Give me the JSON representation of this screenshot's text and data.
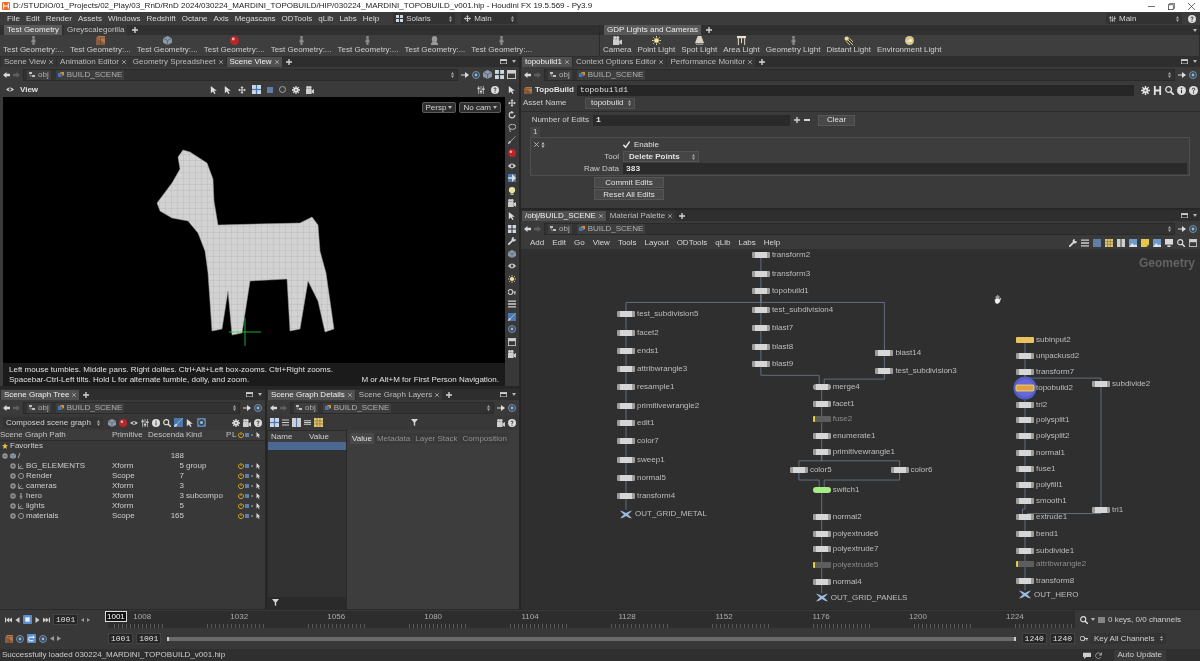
{
  "window": {
    "title": "D:/STUDIO/01_Projects/02_Play/03_RnD/RnD 2024/030224_MARDINI_TOPOBUILD/HIP/030224_MARDINI_TOPOBUILD_v001.hip - Houdini FX 19.5.569 - Py3.9"
  },
  "menu_bar": {
    "items": [
      "File",
      "Edit",
      "Render",
      "Assets",
      "Windows",
      "Redshift",
      "Octane",
      "Axis",
      "Megascans",
      "ODTools",
      "qLib",
      "Labs",
      "Help"
    ],
    "desktop": "Solaris",
    "context": "Main",
    "right_desktop": "Main"
  },
  "shelves": [
    {
      "tabs": [
        {
          "label": "Test Geometry",
          "selected": true
        },
        {
          "label": "Greyscalegorilla",
          "selected": false
        }
      ],
      "tools": [
        "Test Geometry:...",
        "Test Geometry:...",
        "Test Geometry:...",
        "Test Geometry:...",
        "Test Geometry:...",
        "Test Geometry:...",
        "Test Geometry:...",
        "Test Geometry:..."
      ]
    },
    {
      "tabs": [
        {
          "label": "GDP Lights and Cameras",
          "selected": true
        }
      ],
      "tools": [
        "Camera",
        "Point Light",
        "Spot Light",
        "Area Light",
        "Geometry Light",
        "Distant Light",
        "Environment Light"
      ]
    }
  ],
  "scene_view_pane": {
    "tabs": [
      {
        "label": "Scene View",
        "selected": false
      },
      {
        "label": "Animation Editor",
        "selected": false
      },
      {
        "label": "Geometry Spreadsheet",
        "selected": false
      },
      {
        "label": "Scene View",
        "selected": true
      }
    ],
    "path": [
      "obj",
      "BUILD_SCENE"
    ],
    "viewport": {
      "title": "View",
      "camera_menus": [
        "Persp",
        "No cam"
      ],
      "hint": "Left mouse tumbles. Middle pans. Right dollies. Ctrl+Alt+Left box-zooms. Ctrl+Right zooms. Spacebar-Ctrl-Left tilts. Hold L for alternate tumble, dolly, and zoom.",
      "hint_extra": "M or Alt+M for First Person Navigation."
    }
  },
  "scene_graph_tree": {
    "tabs": [
      {
        "label": "Scene Graph Tree",
        "selected": true
      }
    ],
    "path": [
      "obj",
      "BUILD_SCENE"
    ],
    "mode": "Composed scene graph",
    "columns": [
      "Scene Graph Path",
      "Primitive",
      "Descenda",
      "Kind",
      "P",
      "L"
    ],
    "rows": [
      {
        "kind": "favorites",
        "name": "Favorites"
      },
      {
        "kind": "root",
        "name": "/",
        "descendants": "188",
        "expanded": true,
        "children": [
          {
            "kind": "prim",
            "name": "BG_ELEMENTS",
            "primitive": "Xform",
            "descendants": "5",
            "model_kind": "group",
            "expanded": false
          },
          {
            "kind": "prim",
            "name": "Render",
            "primitive": "Scope",
            "descendants": "7",
            "expanded": false
          },
          {
            "kind": "prim",
            "name": "cameras",
            "primitive": "Xform",
            "descendants": "3",
            "expanded": false
          },
          {
            "kind": "prim",
            "name": "hero",
            "primitive": "Xform",
            "descendants": "3",
            "model_kind": "subcompo",
            "expanded": false
          },
          {
            "kind": "prim",
            "name": "lights",
            "primitive": "Xform",
            "descendants": "5",
            "expanded": false
          },
          {
            "kind": "prim",
            "name": "materials",
            "primitive": "Scope",
            "descendants": "165",
            "expanded": false
          }
        ]
      }
    ]
  },
  "scene_graph_details": {
    "tabs": [
      {
        "label": "Scene Graph Details",
        "selected": true
      },
      {
        "label": "Scene Graph Layers",
        "selected": false
      }
    ],
    "path": [
      "obj",
      "BUILD_SCENE"
    ],
    "columns": [
      "Name",
      "Value"
    ],
    "rows": [
      {
        "selected": true
      }
    ],
    "inspector_tabs": [
      {
        "label": "Value",
        "selected": true
      },
      {
        "label": "Metadata",
        "selected": false
      },
      {
        "label": "Layer Stack",
        "selected": false
      },
      {
        "label": "Composition",
        "selected": false
      }
    ]
  },
  "parameter_pane": {
    "tabs": [
      {
        "label": "topobuild1",
        "selected": true
      },
      {
        "label": "Context Options Editor",
        "selected": false
      },
      {
        "label": "Performance Monitor",
        "selected": false
      }
    ],
    "path": [
      "obj",
      "BUILD_SCENE"
    ],
    "node_type": "TopoBuild",
    "node_name": "topobuild1",
    "asset_name": {
      "label": "Asset Name",
      "value": "topobuild"
    },
    "number_of_edits": {
      "label": "Number of Edits",
      "value": "1",
      "clear": "Clear"
    },
    "edits": [
      {
        "index": "1",
        "enable": {
          "label": "Enable",
          "checked": true
        },
        "tool": {
          "label": "Tool",
          "value": "Delete Points"
        },
        "raw_data": {
          "label": "Raw Data",
          "value": "383"
        }
      }
    ],
    "buttons": [
      "Commit Edits",
      "Reset All Edits"
    ]
  },
  "network_pane": {
    "tabs": [
      {
        "label": "/obj/BUILD_SCENE",
        "selected": true
      },
      {
        "label": "Material Palette",
        "selected": false
      }
    ],
    "path": [
      "obj",
      "BUILD_SCENE"
    ],
    "menu": [
      "Add",
      "Edit",
      "Go",
      "View",
      "Tools",
      "Layout",
      "ODTools",
      "qLib",
      "Labs",
      "Help"
    ],
    "context_label": "Geometry",
    "nodes": [
      {
        "name": "transform2",
        "kind": "sop"
      },
      {
        "name": "transform3",
        "kind": "sop"
      },
      {
        "name": "topobuild1",
        "kind": "sop"
      },
      {
        "name": "test_subdivision4",
        "kind": "sop"
      },
      {
        "name": "blast7",
        "kind": "sop"
      },
      {
        "name": "blast8",
        "kind": "sop"
      },
      {
        "name": "blast9",
        "kind": "sop"
      },
      {
        "name": "test_subdivision5",
        "kind": "sop"
      },
      {
        "name": "facet2",
        "kind": "sop"
      },
      {
        "name": "ends1",
        "kind": "sop"
      },
      {
        "name": "attribwrangle3",
        "kind": "sop"
      },
      {
        "name": "resample1",
        "kind": "sop"
      },
      {
        "name": "primitivewrangle2",
        "kind": "sop"
      },
      {
        "name": "edit1",
        "kind": "sop"
      },
      {
        "name": "color7",
        "kind": "sop"
      },
      {
        "name": "sweep1",
        "kind": "sop"
      },
      {
        "name": "normal5",
        "kind": "sop"
      },
      {
        "name": "transform4",
        "kind": "sop"
      },
      {
        "name": "OUT_GRID_METAL",
        "kind": "null"
      },
      {
        "name": "blast14",
        "kind": "sop"
      },
      {
        "name": "test_subdivision3",
        "kind": "sop"
      },
      {
        "name": "merge4",
        "kind": "merge"
      },
      {
        "name": "facet1",
        "kind": "sop"
      },
      {
        "name": "fuse2",
        "kind": "bypassed"
      },
      {
        "name": "enumerate1",
        "kind": "sop"
      },
      {
        "name": "primitivewrangle1",
        "kind": "sop"
      },
      {
        "name": "color5",
        "kind": "sop"
      },
      {
        "name": "color6",
        "kind": "sop"
      },
      {
        "name": "switch1",
        "kind": "switch"
      },
      {
        "name": "normal2",
        "kind": "sop"
      },
      {
        "name": "polyextrude6",
        "kind": "sop"
      },
      {
        "name": "polyextrude7",
        "kind": "sop"
      },
      {
        "name": "polyextrude5",
        "kind": "bypassed"
      },
      {
        "name": "normal4",
        "kind": "sop"
      },
      {
        "name": "OUT_GRID_PANELS",
        "kind": "null"
      },
      {
        "name": "subinput2",
        "kind": "input"
      },
      {
        "name": "unpackusd2",
        "kind": "sop"
      },
      {
        "name": "transform7",
        "kind": "sop"
      },
      {
        "name": "topobuild2",
        "kind": "current"
      },
      {
        "name": "subdivide2",
        "kind": "sop"
      },
      {
        "name": "tri2",
        "kind": "sop"
      },
      {
        "name": "polysplit1",
        "kind": "sop"
      },
      {
        "name": "polysplit2",
        "kind": "sop"
      },
      {
        "name": "normal1",
        "kind": "sop"
      },
      {
        "name": "fuse1",
        "kind": "sop"
      },
      {
        "name": "polyfill1",
        "kind": "sop"
      },
      {
        "name": "smooth1",
        "kind": "sop"
      },
      {
        "name": "tri1",
        "kind": "sop"
      },
      {
        "name": "extrude1",
        "kind": "sop"
      },
      {
        "name": "bend1",
        "kind": "sop"
      },
      {
        "name": "subdivide1",
        "kind": "sop"
      },
      {
        "name": "attribwrangle2",
        "kind": "bypassed"
      },
      {
        "name": "transform8",
        "kind": "sop"
      },
      {
        "name": "OUT_HERO",
        "kind": "null"
      }
    ]
  },
  "timeline": {
    "frame": "1001",
    "marker": "1001",
    "ticks": [
      "1008",
      "1032",
      "1056",
      "1080",
      "1104",
      "1128",
      "1152",
      "1176",
      "1200",
      "1224"
    ],
    "start": [
      "1001",
      "1001"
    ],
    "end": [
      "1240",
      "1240"
    ],
    "keys_info": "0 keys, 0/0 channels",
    "key_mode": "Key All Channels"
  },
  "status_bar": {
    "message": "Successfully loaded 030224_MARDINI_TOPOBUILD_v001.hip",
    "update_mode": "Auto Update"
  }
}
